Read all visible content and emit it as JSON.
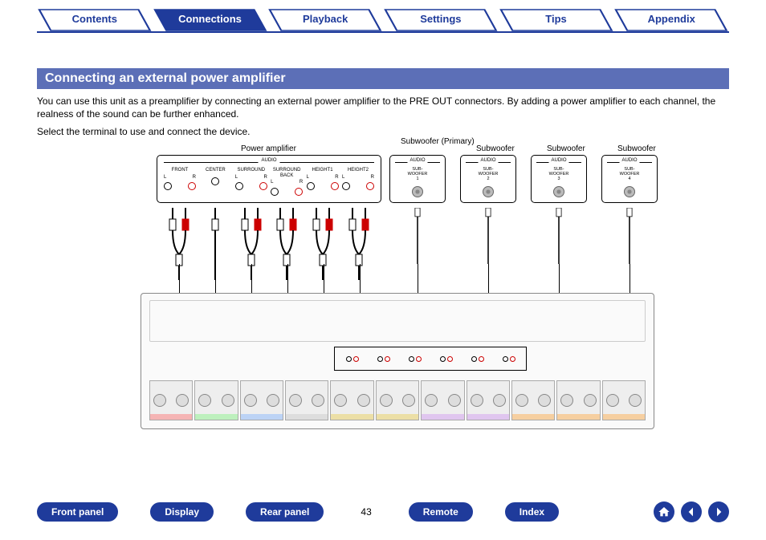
{
  "tabs": {
    "items": [
      {
        "label": "Contents",
        "active": false
      },
      {
        "label": "Connections",
        "active": true
      },
      {
        "label": "Playback",
        "active": false
      },
      {
        "label": "Settings",
        "active": false
      },
      {
        "label": "Tips",
        "active": false
      },
      {
        "label": "Appendix",
        "active": false
      }
    ]
  },
  "section_title": "Connecting an external power amplifier",
  "body": {
    "p1": "You can use this unit as a preamplifier by connecting an external power amplifier to the PRE OUT connectors. By adding a power amplifier to each channel, the realness of the sound can be further enhanced.",
    "p2": "Select the terminal to use and connect the device."
  },
  "diagram": {
    "amp_label": "Power amplifier",
    "audio": "AUDIO",
    "channels": [
      "FRONT",
      "CENTER",
      "SURROUND",
      "SURROUND BACK",
      "HEIGHT1",
      "HEIGHT2"
    ],
    "lr": {
      "l": "L",
      "r": "R"
    },
    "subs": [
      {
        "title": "Subwoofer (Primary)",
        "sub": "SUB-\nWOOFER\n1"
      },
      {
        "title": "Subwoofer",
        "sub": "SUB-\nWOOFER\n2"
      },
      {
        "title": "Subwoofer",
        "sub": "SUB-\nWOOFER\n3"
      },
      {
        "title": "Subwoofer",
        "sub": "SUB-\nWOOFER\n4"
      }
    ]
  },
  "bottom": {
    "front": "Front panel",
    "display": "Display",
    "rear": "Rear panel",
    "page": "43",
    "remote": "Remote",
    "index": "Index"
  }
}
